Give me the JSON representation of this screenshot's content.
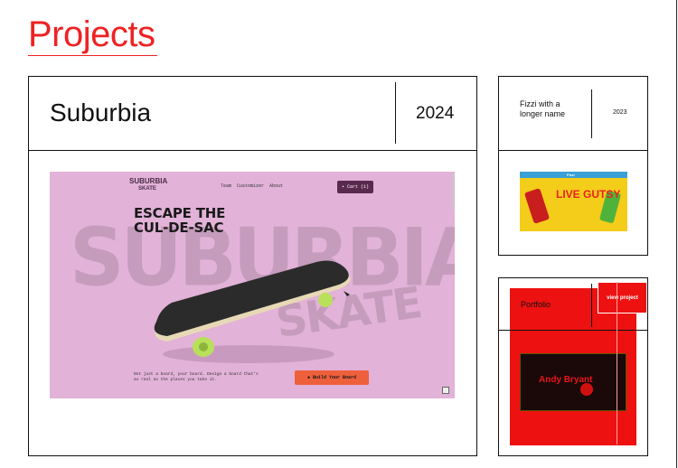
{
  "page": {
    "title": "Projects"
  },
  "main_project": {
    "name": "Suburbia",
    "year": "2024",
    "preview": {
      "logo_line1": "SUBURBIA",
      "logo_line2": "SKATE",
      "nav": [
        "Team",
        "Customizer",
        "About"
      ],
      "cart_label": "Cart (1)",
      "headline_line1": "ESCAPE THE",
      "headline_line2": "CUL-DE-SAC",
      "watermark_line1": "SUBURBIA",
      "watermark_line2": "SKATE",
      "tagline": "Not just a board, your board. Design a board that's as real as the places you take it.",
      "cta_label": "Build Your Board"
    }
  },
  "side_projects": [
    {
      "name": "Fizzi with a longer name",
      "year": "2023",
      "preview": {
        "brand": "Fizzi",
        "headline": "LIVE GUTSY"
      }
    },
    {
      "name": "Portfolio",
      "view_label": "view project",
      "preview": {
        "name_text": "Andy Bryant"
      }
    }
  ],
  "colors": {
    "accent": "#ee2222",
    "suburbia_bg": "#e2b2d8",
    "fizzi_bg": "#f4cc1a",
    "portfolio_red": "#ee1111"
  }
}
